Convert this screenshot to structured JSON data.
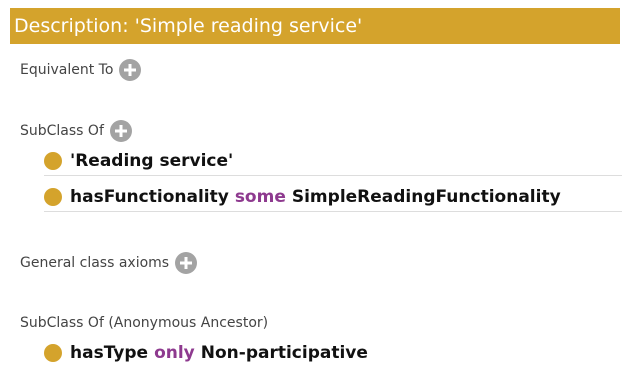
{
  "header": {
    "title": "Description: 'Simple reading service'"
  },
  "colors": {
    "accent": "#d4a32c",
    "keyword": "#8e3a8f",
    "add_button": "#a3a3a3"
  },
  "sections": {
    "equivalent_to": {
      "label": "Equivalent To"
    },
    "subclass_of": {
      "label": "SubClass Of",
      "axioms": [
        {
          "text": "'Reading service'"
        },
        {
          "property": "hasFunctionality",
          "keyword": "some",
          "filler": "SimpleReadingFunctionality"
        }
      ]
    },
    "general_class_axioms": {
      "label": "General class axioms"
    },
    "anonymous_ancestor": {
      "label": "SubClass Of (Anonymous Ancestor)",
      "axioms": [
        {
          "property": "hasType",
          "keyword": "only",
          "filler": "Non-participative"
        }
      ]
    }
  },
  "icons": {
    "add": "plus-circle-icon",
    "class_marker": "class-dot-icon"
  }
}
